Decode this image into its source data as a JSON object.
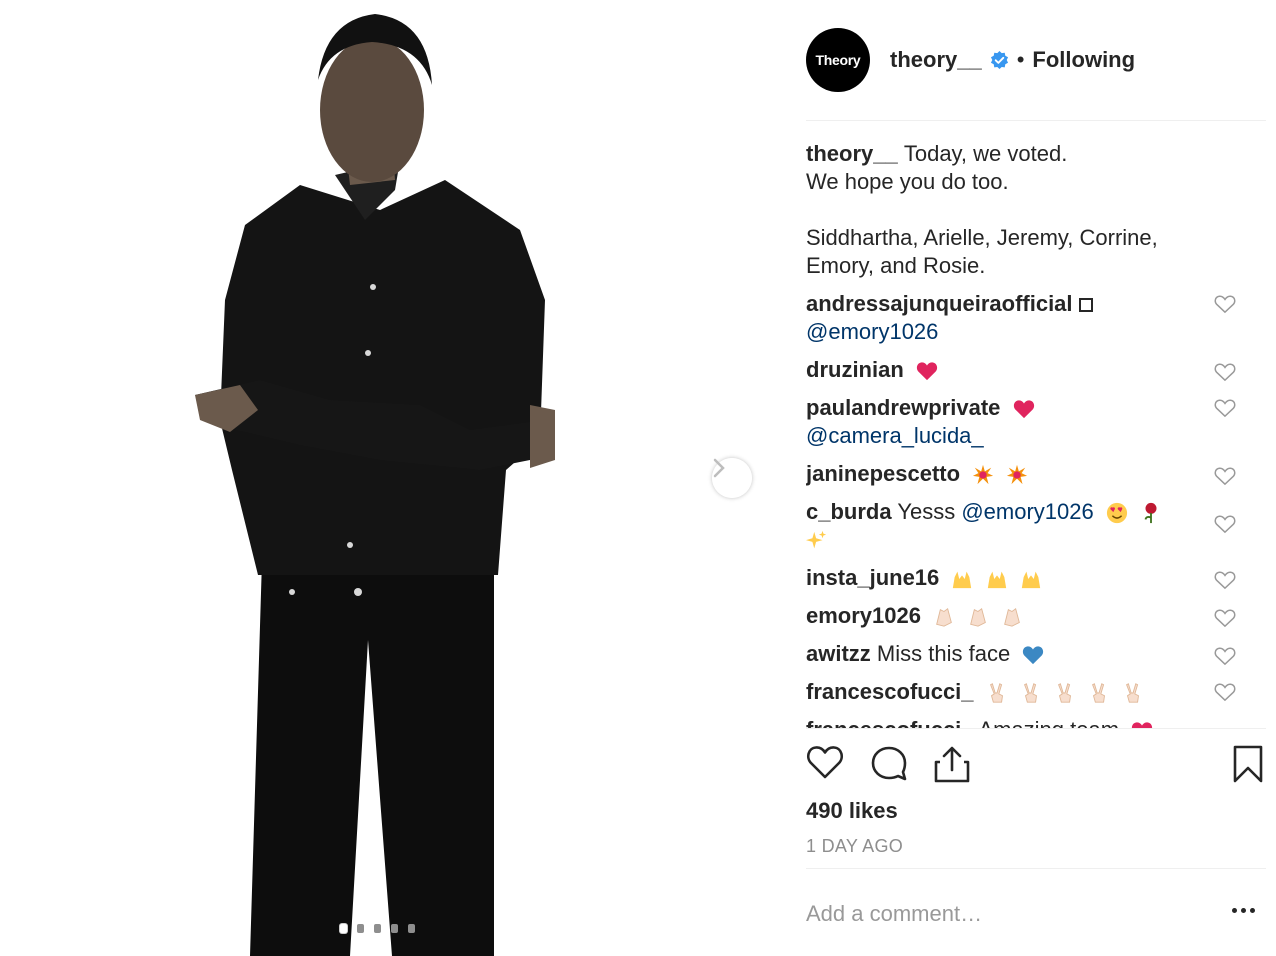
{
  "post": {
    "photo_alt": "black-and-white portrait",
    "carousel_total": 5,
    "carousel_active": 1
  },
  "header": {
    "avatar_text": "Theory",
    "username": "theory__",
    "separator": "•",
    "follow_status": "Following"
  },
  "caption": {
    "username": "theory__",
    "text": "Today, we voted.\nWe hope you do too.\n\nSiddhartha, Arielle, Jeremy, Corrine,\nEmory, and Rosie."
  },
  "comments": [
    {
      "username": "andressajunqueiraofficial",
      "mention": "@emory1026"
    },
    {
      "username": "druzinian"
    },
    {
      "username": "paulandrewprivate",
      "mention": "@camera_lucida_"
    },
    {
      "username": "janinepescetto"
    },
    {
      "username": "c_burda",
      "text": "Yesss",
      "mention": "@emory1026"
    },
    {
      "username": "insta_june16"
    },
    {
      "username": "emory1026"
    },
    {
      "username": "awitzz",
      "text": "Miss this face"
    },
    {
      "username": "francescofucci_"
    },
    {
      "username": "francescofucci_",
      "text": "Amazing team"
    }
  ],
  "engagement": {
    "likes": "490 likes",
    "time_ago": "1 DAY AGO"
  },
  "comment_box": {
    "placeholder": "Add a comment…"
  },
  "colors": {
    "text": "#262626",
    "mention": "#003569",
    "muted": "#8e8e8e",
    "verified": "#3897f0",
    "heart_red": "#e0245e"
  }
}
